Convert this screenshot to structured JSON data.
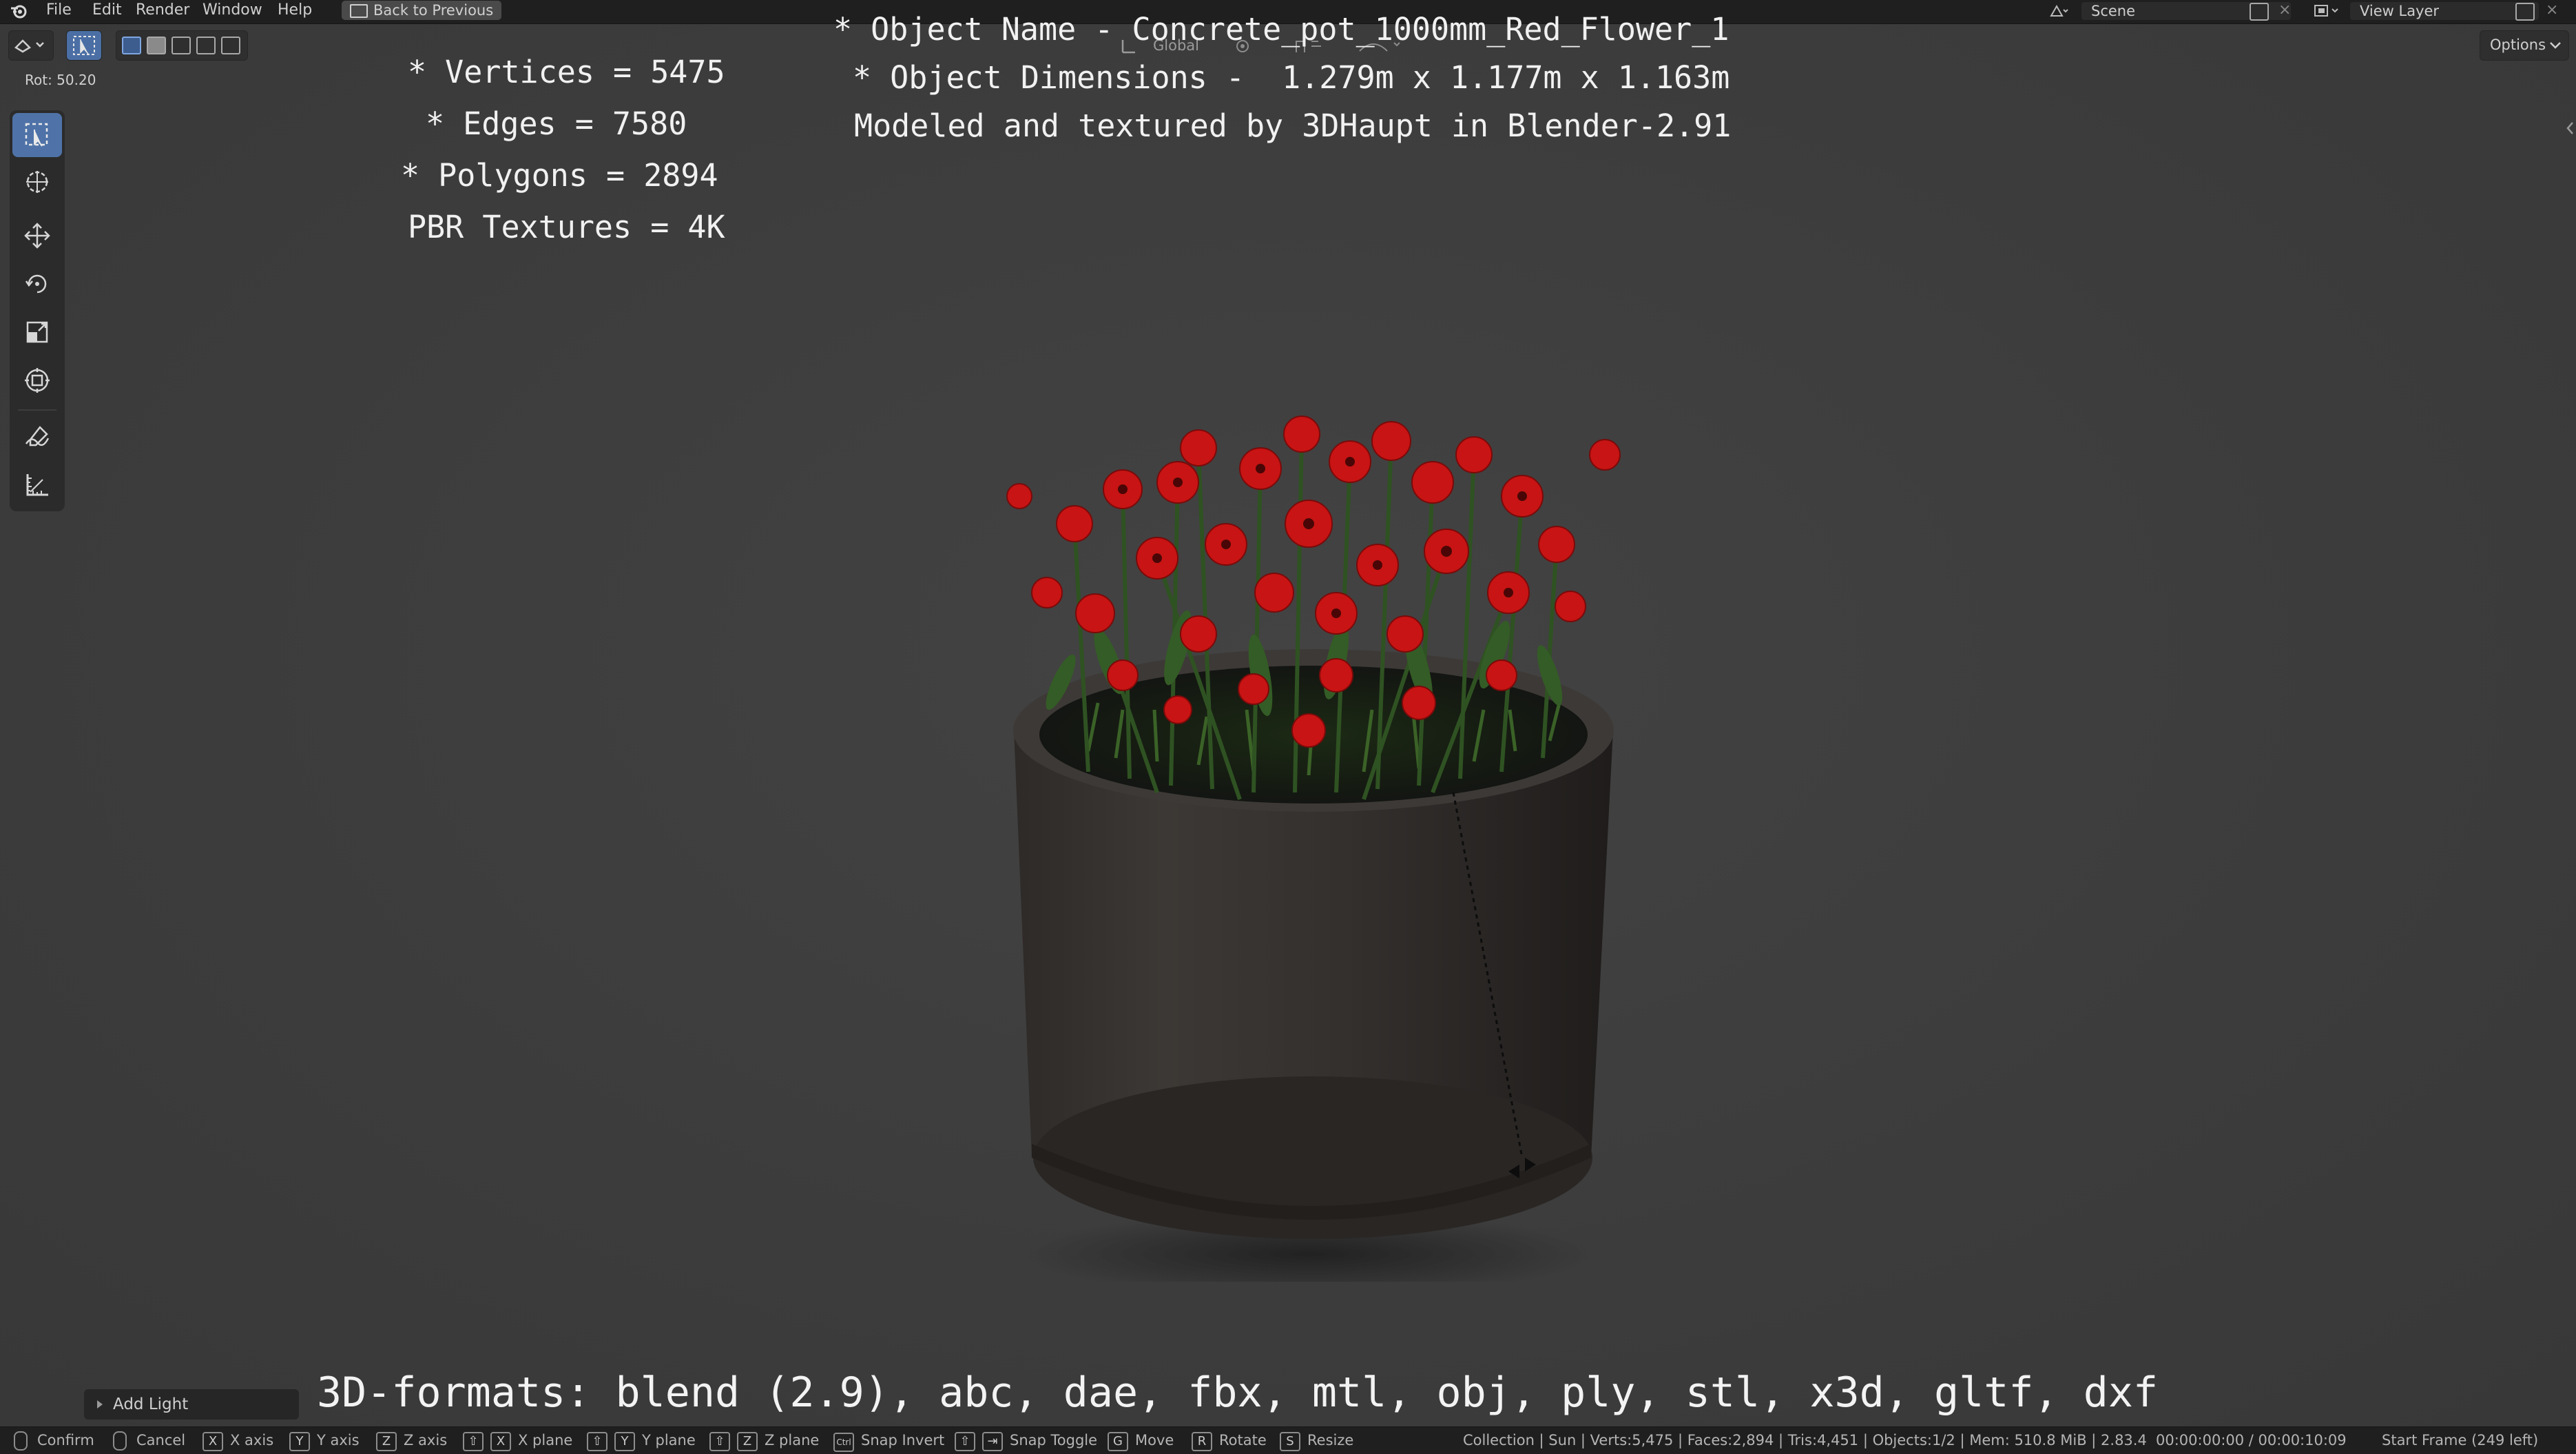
{
  "menu": {
    "items": [
      "File",
      "Edit",
      "Render",
      "Window",
      "Help"
    ],
    "back_button": "Back to Previous",
    "scene_label": "Scene",
    "view_layer_label": "View Layer"
  },
  "viewport_header": {
    "transform_orientation": "Global",
    "options_label": "Options",
    "rotation_readout": "Rot: 50.20"
  },
  "overlay": {
    "vertices": "* Vertices = 5475",
    "edges": "* Edges = 7580",
    "polygons": "* Polygons = 2894",
    "textures": "PBR Textures = 4K",
    "object_name": "* Object Name - Concrete_pot_1000mm_Red_Flower_1",
    "object_dimensions": "* Object Dimensions -  1.279m x 1.177m x 1.163m",
    "credit": "Modeled and textured by 3DHaupt in Blender-2.91",
    "formats": "3D-formats: blend (2.9), abc, dae, fbx, mtl, obj, ply, stl, x3d, gltf, dxf"
  },
  "add_light_panel": {
    "label": "Add Light"
  },
  "toolbar": {
    "tools": [
      "select-box-icon",
      "cursor-icon",
      "move-icon",
      "rotate-icon",
      "scale-icon",
      "transform-icon",
      "annotate-icon",
      "measure-icon"
    ]
  },
  "statusbar": {
    "confirm": "Confirm",
    "cancel": "Cancel",
    "x_key": "X",
    "x_axis": "X axis",
    "y_key": "Y",
    "y_axis": "Y axis",
    "z_key": "Z",
    "z_axis": "Z axis",
    "shift_key": "⇧",
    "x_plane": "X plane",
    "y_plane": "Y plane",
    "z_plane": "Z plane",
    "ctrl_key": "Ctrl",
    "snap_invert": "Snap Invert",
    "tab_key": "⇥",
    "snap_toggle": "Snap Toggle",
    "g_key": "G",
    "move": "Move",
    "r_key": "R",
    "rotate": "Rotate",
    "s_key": "S",
    "resize": "Resize",
    "scene_stats": "Collection | Sun | Verts:5,475 | Faces:2,894 | Tris:4,451 | Objects:1/2 | Mem: 510.8 MiB | 2.83.4",
    "timecode": "00:00:00:00 / 00:00:10:09",
    "start_frame": "Start Frame (249 left)"
  },
  "colors": {
    "viewport_bg": "#3c3c3c",
    "bar_bg": "#1f1f1f",
    "active_tool": "#4f73a8",
    "flower_red": "#c81414",
    "pot": "#3a3634"
  }
}
